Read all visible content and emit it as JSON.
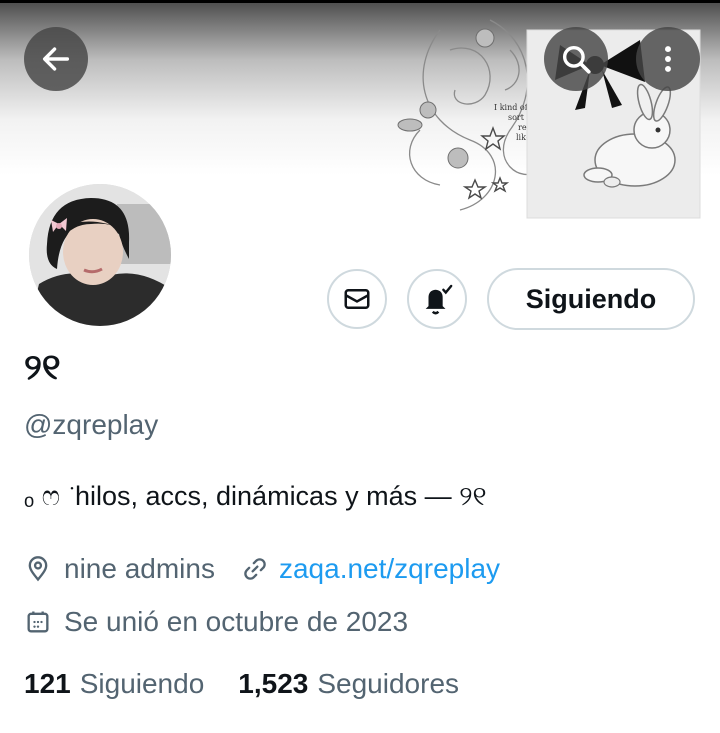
{
  "profile": {
    "name": "୨୧",
    "handle": "@zqreplay",
    "bio": "ₒ ෆ ͘ hilos, accs, dinámicas y más — ୨୧",
    "location": "nine admins",
    "website": "zaqa.net/zqreplay",
    "joined": "Se unió en octubre de 2023"
  },
  "actions": {
    "follow_label": "Siguiendo"
  },
  "stats": {
    "following_count": "121",
    "following_label": "Siguiendo",
    "followers_count": "1,523",
    "followers_label": "Seguidores"
  },
  "banner": {
    "text_lines": [
      "I kind of",
      "sort of",
      "really",
      "like you"
    ]
  },
  "icons": [
    "back-arrow-icon",
    "search-icon",
    "more-vertical-icon",
    "mail-icon",
    "bell-check-icon",
    "location-pin-icon",
    "link-icon",
    "calendar-icon"
  ],
  "colors": {
    "link": "#1d9bf0",
    "secondary_text": "#536471",
    "primary_text": "#0f1419",
    "border": "#cfd9de"
  }
}
